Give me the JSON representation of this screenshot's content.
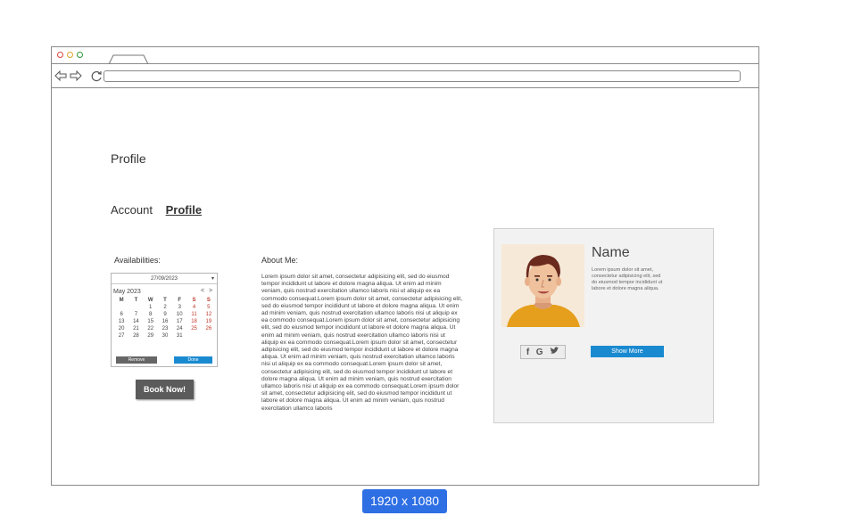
{
  "browser": {
    "url": ""
  },
  "page": {
    "title": "Profile",
    "nav": {
      "account_label": "Account",
      "profile_label": "Profile"
    }
  },
  "availability": {
    "label": "Availabilities:",
    "date_value": "27/09/2023",
    "month_label": "May 2023",
    "prev": "<",
    "next": ">",
    "weekday_headers": [
      "M",
      "T",
      "W",
      "T",
      "F",
      "S",
      "S"
    ],
    "weeks": [
      [
        "",
        "",
        "1",
        "2",
        "3",
        "4",
        "5"
      ],
      [
        "6",
        "7",
        "8",
        "9",
        "10",
        "11",
        "12"
      ],
      [
        "13",
        "14",
        "15",
        "16",
        "17",
        "18",
        "19"
      ],
      [
        "20",
        "21",
        "22",
        "23",
        "24",
        "25",
        "26"
      ],
      [
        "27",
        "28",
        "29",
        "30",
        "31",
        "",
        ""
      ]
    ],
    "remove_label": "Remove",
    "done_label": "Done",
    "book_label": "Book Now!"
  },
  "about": {
    "label": "About Me:",
    "text": "Lorem ipsum dolor sit amet, consectetur adipisicing elit, sed do eiusmod tempor incididunt ut labore et dolore magna aliqua. Ut enim ad minim veniam, quis nostrud exercitation ullamco laboris nisi ut aliquip ex ea commodo consequat.Lorem ipsum dolor sit amet, consectetur adipisicing elit, sed do eiusmod tempor incididunt ut labore et dolore magna aliqua. Ut enim ad minim veniam, quis nostrud exercitation ullamco laboris nisi ut aliquip ex ea commodo consequat.Lorem ipsum dolor sit amet, consectetur adipisicing elit, sed do eiusmod tempor incididunt ut labore et dolore magna aliqua. Ut enim ad minim veniam, quis nostrud exercitation ullamco laboris nisi ut aliquip ex ea commodo consequat.Lorem ipsum dolor sit amet, consectetur adipisicing elit, sed do eiusmod tempor incididunt ut labore et dolore magna aliqua. Ut enim ad minim veniam, quis nostrud exercitation ullamco laboris nisi ut aliquip ex ea commodo consequat.Lorem ipsum dolor sit amet, consectetur adipisicing elit, sed do eiusmod tempor incididunt ut labore et dolore magna aliqua. Ut enim ad minim veniam, quis nostrud exercitation ullamco laboris nisi ut aliquip ex ea commodo consequat.Lorem ipsum dolor sit amet, consectetur adipisicing elit, sed do eiusmod tempor incididunt ut labore et dolore magna aliqua. Ut enim ad minim veniam, quis nostrud exercitation ullamco laboris"
  },
  "card": {
    "name": "Name",
    "description": "Lorem ipsum dolor sit amet, consectetur adipisicing elit, sed do eiusmod tempor incididunt ut labore et dolore magna aliqua.",
    "social_icons": [
      "facebook-icon",
      "google-icon",
      "twitter-icon"
    ],
    "social_glyphs": {
      "facebook": "f",
      "google": "G",
      "twitter": "❧"
    },
    "show_more_label": "Show More"
  },
  "resolution_badge": "1920 x 1080",
  "colors": {
    "accent_blue": "#1a8ad0",
    "dark_button": "#5b5b5b",
    "badge_blue": "#2f6fe4",
    "weekend_red": "#c0392b"
  }
}
